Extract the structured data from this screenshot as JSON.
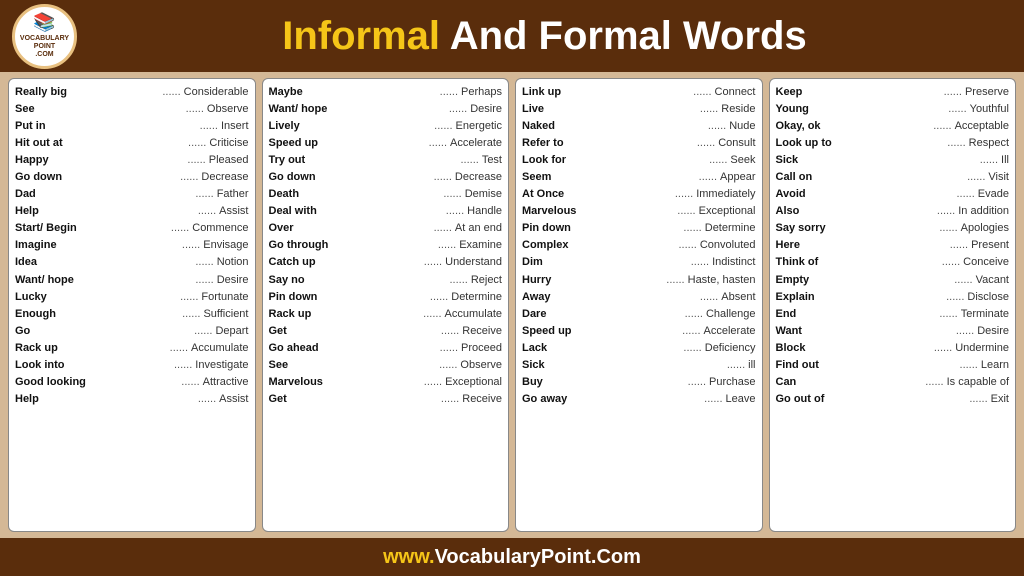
{
  "header": {
    "title_informal": "Informal",
    "title_rest": " And Formal Words",
    "logo_line1": "VOCABULARY",
    "logo_line2": "POINT",
    "logo_line3": ".COM"
  },
  "footer": {
    "text_prefix": "www.",
    "text_domain": "VocabularyPoint.Com"
  },
  "columns": [
    {
      "id": "col1",
      "pairs": [
        {
          "informal": "Really big",
          "dots": "......",
          "formal": "Considerable"
        },
        {
          "informal": "See",
          "dots": "......",
          "formal": "Observe"
        },
        {
          "informal": "Put in",
          "dots": "......",
          "formal": "Insert"
        },
        {
          "informal": "Hit out at",
          "dots": "......",
          "formal": "Criticise"
        },
        {
          "informal": "Happy",
          "dots": "......",
          "formal": "Pleased"
        },
        {
          "informal": "Go down",
          "dots": "......",
          "formal": "Decrease"
        },
        {
          "informal": "Dad",
          "dots": "......",
          "formal": "Father"
        },
        {
          "informal": "Help",
          "dots": "......",
          "formal": "Assist"
        },
        {
          "informal": "Start/ Begin",
          "dots": "......",
          "formal": "Commence"
        },
        {
          "informal": "Imagine",
          "dots": "......",
          "formal": "Envisage"
        },
        {
          "informal": "Idea",
          "dots": "......",
          "formal": "Notion"
        },
        {
          "informal": "Want/ hope",
          "dots": "......",
          "formal": "Desire"
        },
        {
          "informal": "Lucky",
          "dots": "......",
          "formal": "Fortunate"
        },
        {
          "informal": "Enough",
          "dots": "......",
          "formal": "Sufficient"
        },
        {
          "informal": "Go",
          "dots": "......",
          "formal": "Depart"
        },
        {
          "informal": "Rack up",
          "dots": "......",
          "formal": "Accumulate"
        },
        {
          "informal": "Look into",
          "dots": "......",
          "formal": "Investigate"
        },
        {
          "informal": "Good looking",
          "dots": "......",
          "formal": "Attractive"
        },
        {
          "informal": "Help",
          "dots": "......",
          "formal": "Assist"
        }
      ]
    },
    {
      "id": "col2",
      "pairs": [
        {
          "informal": "Maybe",
          "dots": "......",
          "formal": "Perhaps"
        },
        {
          "informal": "Want/ hope",
          "dots": "......",
          "formal": "Desire"
        },
        {
          "informal": "Lively",
          "dots": "......",
          "formal": "Energetic"
        },
        {
          "informal": "Speed up",
          "dots": "......",
          "formal": "Accelerate"
        },
        {
          "informal": "Try out",
          "dots": "......",
          "formal": "Test"
        },
        {
          "informal": "Go down",
          "dots": "......",
          "formal": "Decrease"
        },
        {
          "informal": "Death",
          "dots": "......",
          "formal": "Demise"
        },
        {
          "informal": "Deal with",
          "dots": "......",
          "formal": "Handle"
        },
        {
          "informal": "Over",
          "dots": "......",
          "formal": "At an end"
        },
        {
          "informal": "Go through",
          "dots": "......",
          "formal": "Examine"
        },
        {
          "informal": "Catch up",
          "dots": "......",
          "formal": "Understand"
        },
        {
          "informal": "Say no",
          "dots": "......",
          "formal": "Reject"
        },
        {
          "informal": "Pin down",
          "dots": "......",
          "formal": "Determine"
        },
        {
          "informal": "Rack up",
          "dots": "......",
          "formal": "Accumulate"
        },
        {
          "informal": "Get",
          "dots": "......",
          "formal": "Receive"
        },
        {
          "informal": "Go ahead",
          "dots": "......",
          "formal": "Proceed"
        },
        {
          "informal": "See",
          "dots": "......",
          "formal": "Observe"
        },
        {
          "informal": "Marvelous",
          "dots": "......",
          "formal": "Exceptional"
        },
        {
          "informal": "Get",
          "dots": "......",
          "formal": "Receive"
        }
      ]
    },
    {
      "id": "col3",
      "pairs": [
        {
          "informal": "Link up",
          "dots": "......",
          "formal": "Connect"
        },
        {
          "informal": "Live",
          "dots": "......",
          "formal": "Reside"
        },
        {
          "informal": "Naked",
          "dots": "......",
          "formal": "Nude"
        },
        {
          "informal": "Refer to",
          "dots": "......",
          "formal": "Consult"
        },
        {
          "informal": "Look for",
          "dots": "......",
          "formal": "Seek"
        },
        {
          "informal": "Seem",
          "dots": "......",
          "formal": "Appear"
        },
        {
          "informal": "At Once",
          "dots": "......",
          "formal": "Immediately"
        },
        {
          "informal": "Marvelous",
          "dots": "......",
          "formal": "Exceptional"
        },
        {
          "informal": "Pin down",
          "dots": "......",
          "formal": "Determine"
        },
        {
          "informal": "Complex",
          "dots": "......",
          "formal": "Convoluted"
        },
        {
          "informal": "Dim",
          "dots": "......",
          "formal": "Indistinct"
        },
        {
          "informal": "Hurry",
          "dots": "......",
          "formal": "Haste, hasten"
        },
        {
          "informal": "Away",
          "dots": "......",
          "formal": "Absent"
        },
        {
          "informal": "Dare",
          "dots": "......",
          "formal": "Challenge"
        },
        {
          "informal": "Speed up",
          "dots": "......",
          "formal": "Accelerate"
        },
        {
          "informal": "Lack",
          "dots": "......",
          "formal": "Deficiency"
        },
        {
          "informal": "Sick",
          "dots": "......",
          "formal": "ill"
        },
        {
          "informal": "Buy",
          "dots": "......",
          "formal": "Purchase"
        },
        {
          "informal": "Go away",
          "dots": "......",
          "formal": "Leave"
        }
      ]
    },
    {
      "id": "col4",
      "pairs": [
        {
          "informal": "Keep",
          "dots": "......",
          "formal": "Preserve"
        },
        {
          "informal": "Young",
          "dots": "......",
          "formal": "Youthful"
        },
        {
          "informal": "Okay, ok",
          "dots": "......",
          "formal": "Acceptable"
        },
        {
          "informal": "Look up to",
          "dots": "......",
          "formal": "Respect"
        },
        {
          "informal": "Sick",
          "dots": "......",
          "formal": "Ill"
        },
        {
          "informal": "Call on",
          "dots": "......",
          "formal": "Visit"
        },
        {
          "informal": "Avoid",
          "dots": "......",
          "formal": "Evade"
        },
        {
          "informal": "Also",
          "dots": "......",
          "formal": "In addition"
        },
        {
          "informal": "Say sorry",
          "dots": "......",
          "formal": "Apologies"
        },
        {
          "informal": "Here",
          "dots": "......",
          "formal": "Present"
        },
        {
          "informal": "Think of",
          "dots": "......",
          "formal": "Conceive"
        },
        {
          "informal": "Empty",
          "dots": "......",
          "formal": "Vacant"
        },
        {
          "informal": "Explain",
          "dots": "......",
          "formal": "Disclose"
        },
        {
          "informal": "End",
          "dots": "......",
          "formal": "Terminate"
        },
        {
          "informal": "Want",
          "dots": "......",
          "formal": "Desire"
        },
        {
          "informal": "Block",
          "dots": "......",
          "formal": "Undermine"
        },
        {
          "informal": "Find out",
          "dots": "......",
          "formal": "Learn"
        },
        {
          "informal": "Can",
          "dots": "......",
          "formal": "Is capable of"
        },
        {
          "informal": "Go out of",
          "dots": "......",
          "formal": "Exit"
        }
      ]
    }
  ]
}
